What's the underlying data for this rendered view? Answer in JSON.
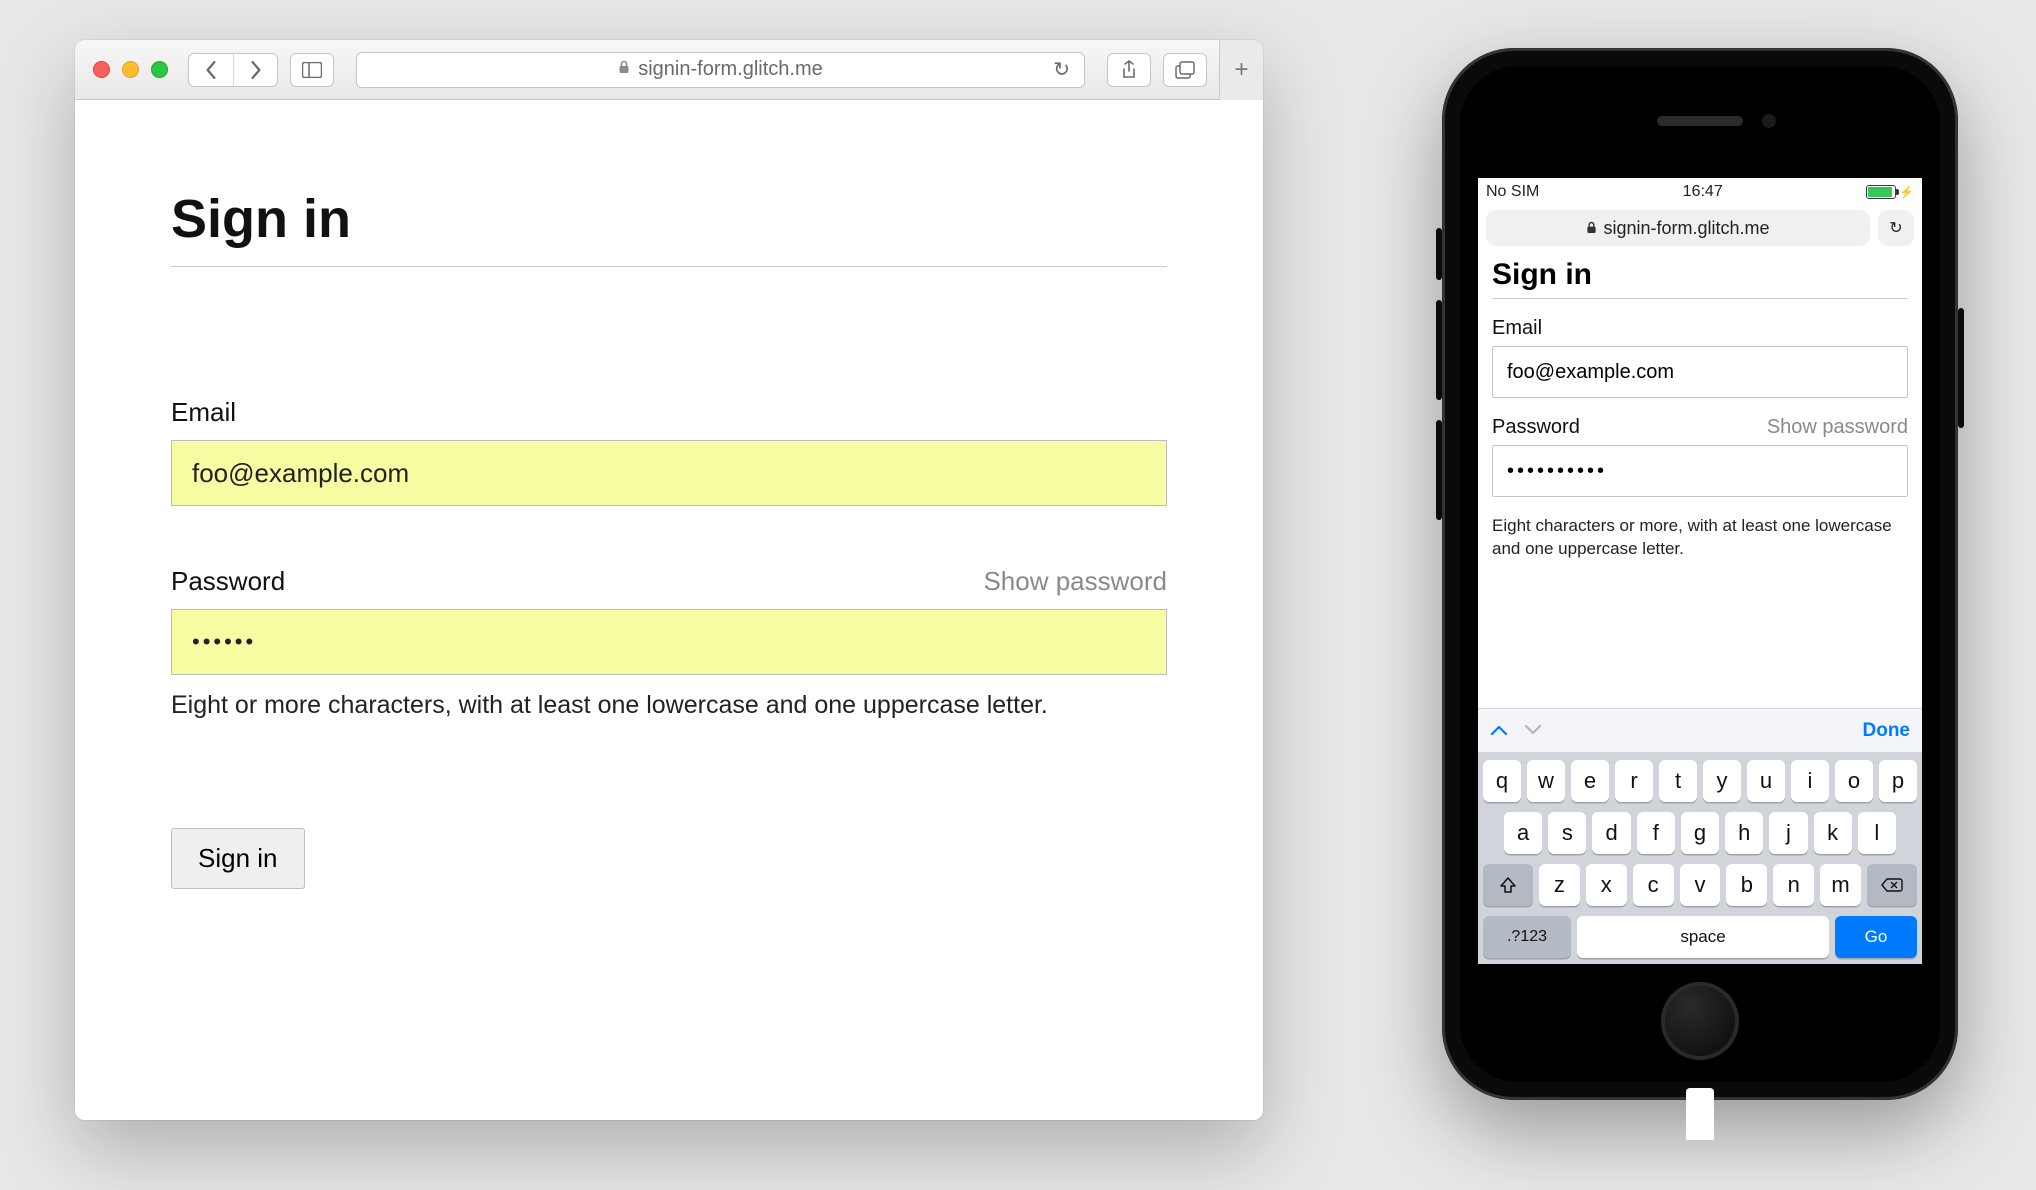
{
  "desktop": {
    "url": "signin-form.glitch.me",
    "form": {
      "title": "Sign in",
      "email_label": "Email",
      "email_value": "foo@example.com",
      "password_label": "Password",
      "show_password": "Show password",
      "password_mask": "••••••",
      "password_hint": "Eight or more characters, with at least one lowercase and one uppercase letter.",
      "submit_label": "Sign in"
    }
  },
  "mobile": {
    "status": {
      "carrier": "No SIM",
      "time": "16:47"
    },
    "url": "signin-form.glitch.me",
    "form": {
      "title": "Sign in",
      "email_label": "Email",
      "email_value": "foo@example.com",
      "password_label": "Password",
      "show_password": "Show password",
      "password_mask": "••••••••••",
      "password_hint": "Eight characters or more, with at least one lowercase and one uppercase letter."
    },
    "keyboard": {
      "done": "Done",
      "rows": {
        "r1": [
          "q",
          "w",
          "e",
          "r",
          "t",
          "y",
          "u",
          "i",
          "o",
          "p"
        ],
        "r2": [
          "a",
          "s",
          "d",
          "f",
          "g",
          "h",
          "j",
          "k",
          "l"
        ],
        "r3": [
          "z",
          "x",
          "c",
          "v",
          "b",
          "n",
          "m"
        ]
      },
      "mode": ".?123",
      "space": "space",
      "go": "Go"
    }
  }
}
